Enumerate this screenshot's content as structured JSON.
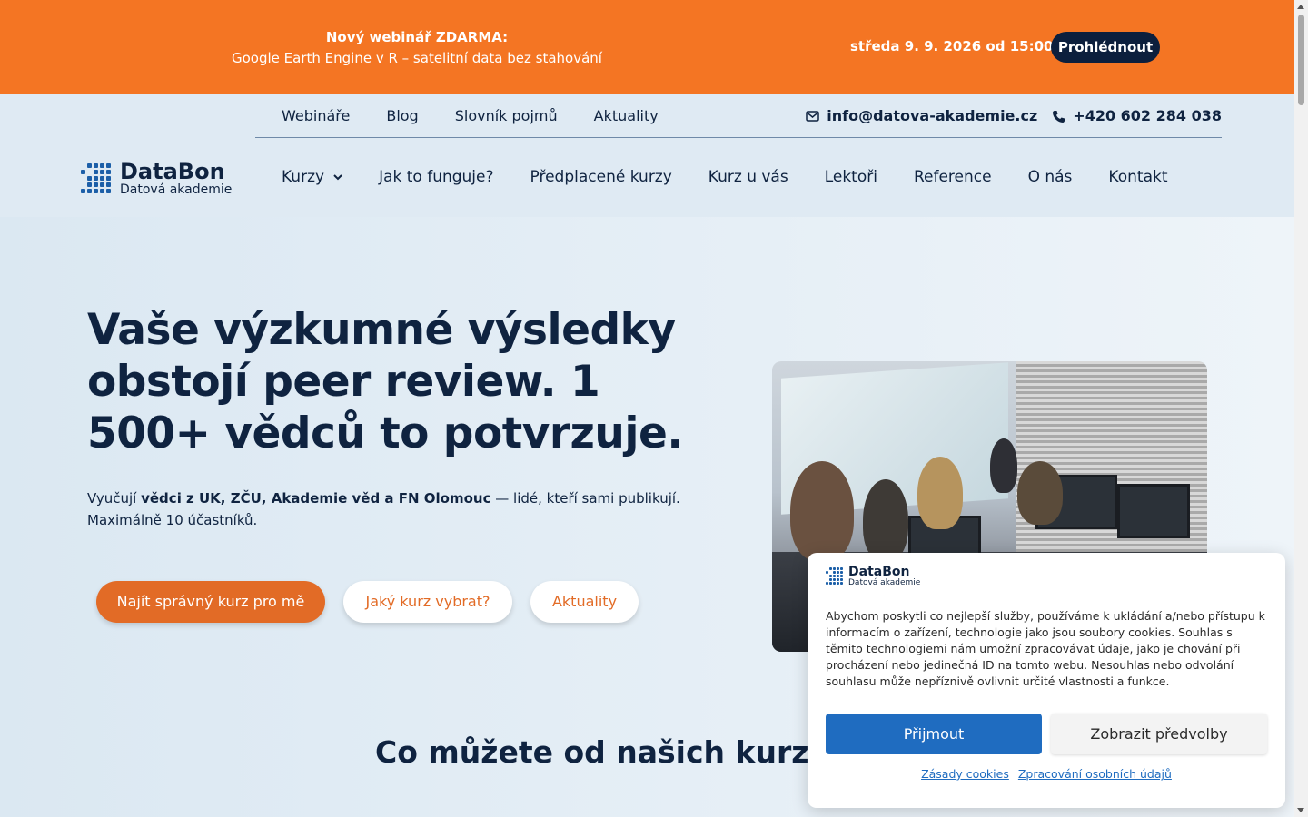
{
  "promo": {
    "title": "Nový webinář ZDARMA:",
    "subtitle": "Google Earth Engine v R – satelitní data bez stahování",
    "date": "středa 9. 9. 2026 od 15:00",
    "button": "Prohlédnout"
  },
  "util_nav": [
    "Webináře",
    "Blog",
    "Slovník pojmů",
    "Aktuality"
  ],
  "contact": {
    "email": "info@datova-akademie.cz",
    "phone": "+420 602 284 038"
  },
  "logo": {
    "name": "DataBon",
    "tagline": "Datová akademie"
  },
  "main_nav": [
    "Kurzy",
    "Jak to funguje?",
    "Předplacené kurzy",
    "Kurz u vás",
    "Lektoři",
    "Reference",
    "O nás",
    "Kontakt"
  ],
  "hero": {
    "title": "Vaše výzkumné výsledky obstojí peer review. 1 500+ vědců to potvrzuje.",
    "text_prefix": "Vyučují ",
    "text_bold": "vědci z UK, ZČU, Akademie věd a FN Olomouc",
    "text_suffix": " — lidé, kteří sami publikují. Maximálně 10 účastníků.",
    "btn_primary": "Najít správný kurz pro mě",
    "btn_secondary": "Jaký kurz vybrat?",
    "btn_tertiary": "Aktuality"
  },
  "section_title": "Co můžete od našich kurzů oč",
  "cookie": {
    "text": "Abychom poskytli co nejlepší služby, používáme k ukládání a/nebo přístupu k informacím o zařízení, technologie jako jsou soubory cookies. Souhlas s těmito technologiemi nám umožní zpracovávat údaje, jako je chování při procházení nebo jedinečná ID na tomto webu. Nesouhlas nebo odvolání souhlasu může nepříznivě ovlivnit určité vlastnosti a funkce.",
    "accept": "Přijmout",
    "preferences": "Zobrazit předvolby",
    "link_cookies": "Zásady cookies",
    "link_privacy": "Zpracování osobních údajů"
  },
  "colors": {
    "orange": "#f47523",
    "navy": "#0f2340",
    "blue": "#1f6cc0"
  }
}
